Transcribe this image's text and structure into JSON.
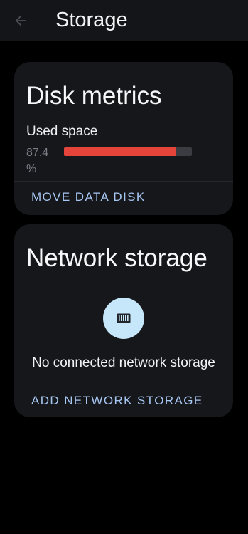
{
  "header": {
    "title": "Storage",
    "back_icon": "arrow-left-icon"
  },
  "disk_metrics": {
    "title": "Disk metrics",
    "used_space_label": "Used space",
    "used_space_value": "87.4 %",
    "used_space_fraction": 0.874,
    "bar_color": "#e5443b",
    "action_label": "MOVE DATA DISK"
  },
  "network_storage": {
    "title": "Network storage",
    "icon": "nas-drive-icon",
    "empty_message": "No connected network storage",
    "action_label": "ADD NETWORK STORAGE"
  },
  "colors": {
    "background": "#000000",
    "card": "#16171b",
    "accent": "#a7c7f3",
    "icon_circle": "#c6e7fa"
  }
}
